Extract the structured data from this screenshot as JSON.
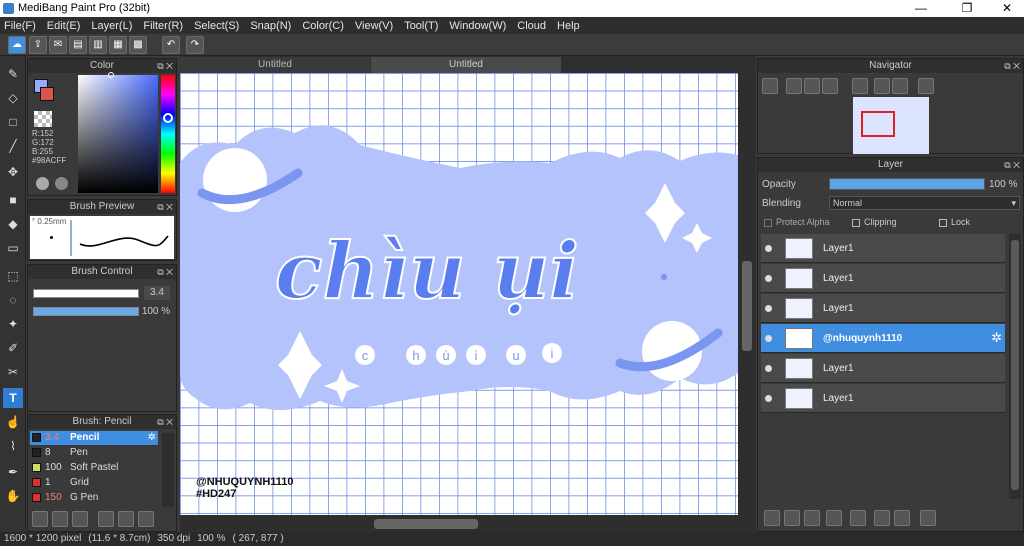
{
  "window": {
    "title": "MediBang Paint Pro (32bit)",
    "minimize": "—",
    "maximize": "❐",
    "close": "✕"
  },
  "menu": [
    "File(F)",
    "Edit(E)",
    "Layer(L)",
    "Filter(R)",
    "Select(S)",
    "Snap(N)",
    "Color(C)",
    "View(V)",
    "Tool(T)",
    "Window(W)",
    "Cloud",
    "Help"
  ],
  "tabs": [
    {
      "label": "Untitled"
    },
    {
      "label": "Untitled"
    }
  ],
  "color_panel": {
    "title": "Color",
    "r": "R:152",
    "g": "G:172",
    "b": "B:255",
    "hex": "#98ACFF",
    "fg": "#98acff",
    "bg": "#ffffff"
  },
  "brush_preview": {
    "title": "Brush Preview",
    "size": "° 0.25mm"
  },
  "brush_control": {
    "title": "Brush Control",
    "size_value": "3.4",
    "opacity_value": "100 %"
  },
  "brush_list": {
    "title": "Brush: Pencil",
    "items": [
      {
        "size": "3.4",
        "name": "Pencil",
        "color": "#222222"
      },
      {
        "size": "8",
        "name": "Pen",
        "color": "#222222"
      },
      {
        "size": "100",
        "name": "Soft Pastel",
        "color": "#c8e05a"
      },
      {
        "size": "1",
        "name": "Grid",
        "color": "#e03030"
      },
      {
        "size": "150",
        "name": "G Pen",
        "color": "#e03030"
      }
    ]
  },
  "navigator": {
    "title": "Navigator"
  },
  "layer_panel": {
    "title": "Layer",
    "opacity_label": "Opacity",
    "opacity_value": "100 %",
    "opacity": 1.0,
    "blending_label": "Blending",
    "blending_value": "Normal",
    "protect_alpha": "Protect Alpha",
    "clipping": "Clipping",
    "lock": "Lock",
    "layers": [
      {
        "name": "Layer1",
        "selected": false
      },
      {
        "name": "Layer1",
        "selected": false
      },
      {
        "name": "Layer1",
        "selected": false
      },
      {
        "name": "@nhuquynh1110",
        "selected": true
      },
      {
        "name": "Layer1",
        "selected": false
      },
      {
        "name": "Layer1",
        "selected": false
      }
    ]
  },
  "artwork": {
    "title_text": "chìu ụi",
    "sub_text": [
      "c",
      "h",
      "ù",
      "i",
      "u",
      "i"
    ],
    "watermark_line1": "@NHUQUYNH1110",
    "watermark_line2": "#HD247",
    "grid_color": "#6f8fe6",
    "cloud_color": "#b4c3fb",
    "letter_color": "#5a7ef0"
  },
  "status": {
    "size": "1600 * 1200 pixel",
    "mm": "(11.6 * 8.7cm)",
    "dpi": "350 dpi",
    "zoom": "100 %",
    "coords": "( 267, 877 )"
  }
}
